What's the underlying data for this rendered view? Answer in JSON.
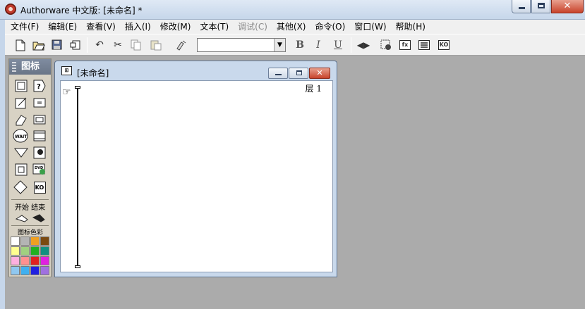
{
  "app": {
    "title": "Authorware 中文版: [未命名] *",
    "window_buttons": {
      "minimize": "",
      "maximize": "",
      "close": "✕"
    }
  },
  "menu": [
    "文件(F)",
    "编辑(E)",
    "查看(V)",
    "插入(I)",
    "修改(M)",
    "文本(T)",
    "调试(C)",
    "其他(X)",
    "命令(O)",
    "窗口(W)",
    "帮助(H)"
  ],
  "menu_disabled": [
    "调试(C)"
  ],
  "toolbar": {
    "font_select_value": "",
    "bold": "B",
    "italic": "I",
    "underline": "U",
    "calc_label": "fx"
  },
  "palette": {
    "title": "图标",
    "start_end_label": "开始 结束",
    "color_label": "图标色彩",
    "wait_label": "WAIT",
    "dvd_label": "DVD",
    "ko_label": "KO",
    "swatch_colors": [
      "#ffffff",
      "#b4b4b4",
      "#f0a020",
      "#7a4a10",
      "#ffff90",
      "#a0d080",
      "#20b020",
      "#109080",
      "#ffb0e0",
      "#ff9090",
      "#e02020",
      "#e020e0",
      "#90c8f0",
      "#40b0f0",
      "#2020e0",
      "#a070e0"
    ]
  },
  "flow_window": {
    "title": "[未命名]",
    "layer_label": "层 1"
  }
}
